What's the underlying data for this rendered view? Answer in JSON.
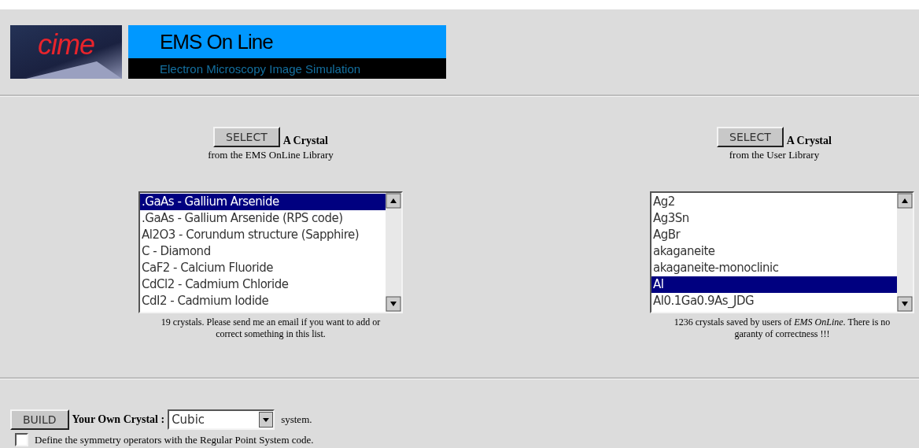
{
  "header": {
    "logo": "cime",
    "title": "EMS On Line",
    "subtitle": "Electron Microscopy Image Simulation"
  },
  "libraries": [
    {
      "button": "SELECT",
      "heading": "A Crystal",
      "source": "from the EMS OnLine Library",
      "items": [
        {
          "label": ".GaAs - Gallium Arsenide",
          "selected": true
        },
        {
          "label": ".GaAs - Gallium Arsenide (RPS code)",
          "selected": false
        },
        {
          "label": "Al2O3 - Corundum structure (Sapphire)",
          "selected": false
        },
        {
          "label": "C - Diamond",
          "selected": false
        },
        {
          "label": "CaF2 - Calcium Fluoride",
          "selected": false
        },
        {
          "label": "CdCl2 - Cadmium Chloride",
          "selected": false
        },
        {
          "label": "CdI2 - Cadmium Iodide",
          "selected": false
        }
      ],
      "note": "19 crystals. Please send me an email if you want to add or correct something in this list."
    },
    {
      "button": "SELECT",
      "heading": "A Crystal",
      "source": "from the User Library",
      "items": [
        {
          "label": "Ag2",
          "selected": false
        },
        {
          "label": "Ag3Sn",
          "selected": false
        },
        {
          "label": "AgBr",
          "selected": false
        },
        {
          "label": "akaganeite",
          "selected": false
        },
        {
          "label": "akaganeite-monoclinic",
          "selected": false
        },
        {
          "label": "Al",
          "selected": true
        },
        {
          "label": "Al0.1Ga0.9As_JDG",
          "selected": false
        }
      ],
      "note": "1236 crystals saved by users of *EMS OnLine*. There is no garanty of correctness !!!"
    }
  ],
  "build": {
    "button": "BUILD",
    "label": "Your Own Crystal :",
    "system": "Cubic",
    "suffix": "system."
  },
  "option": {
    "label": "Define the symmetry operators with the Regular Point System code.",
    "checked": false
  }
}
